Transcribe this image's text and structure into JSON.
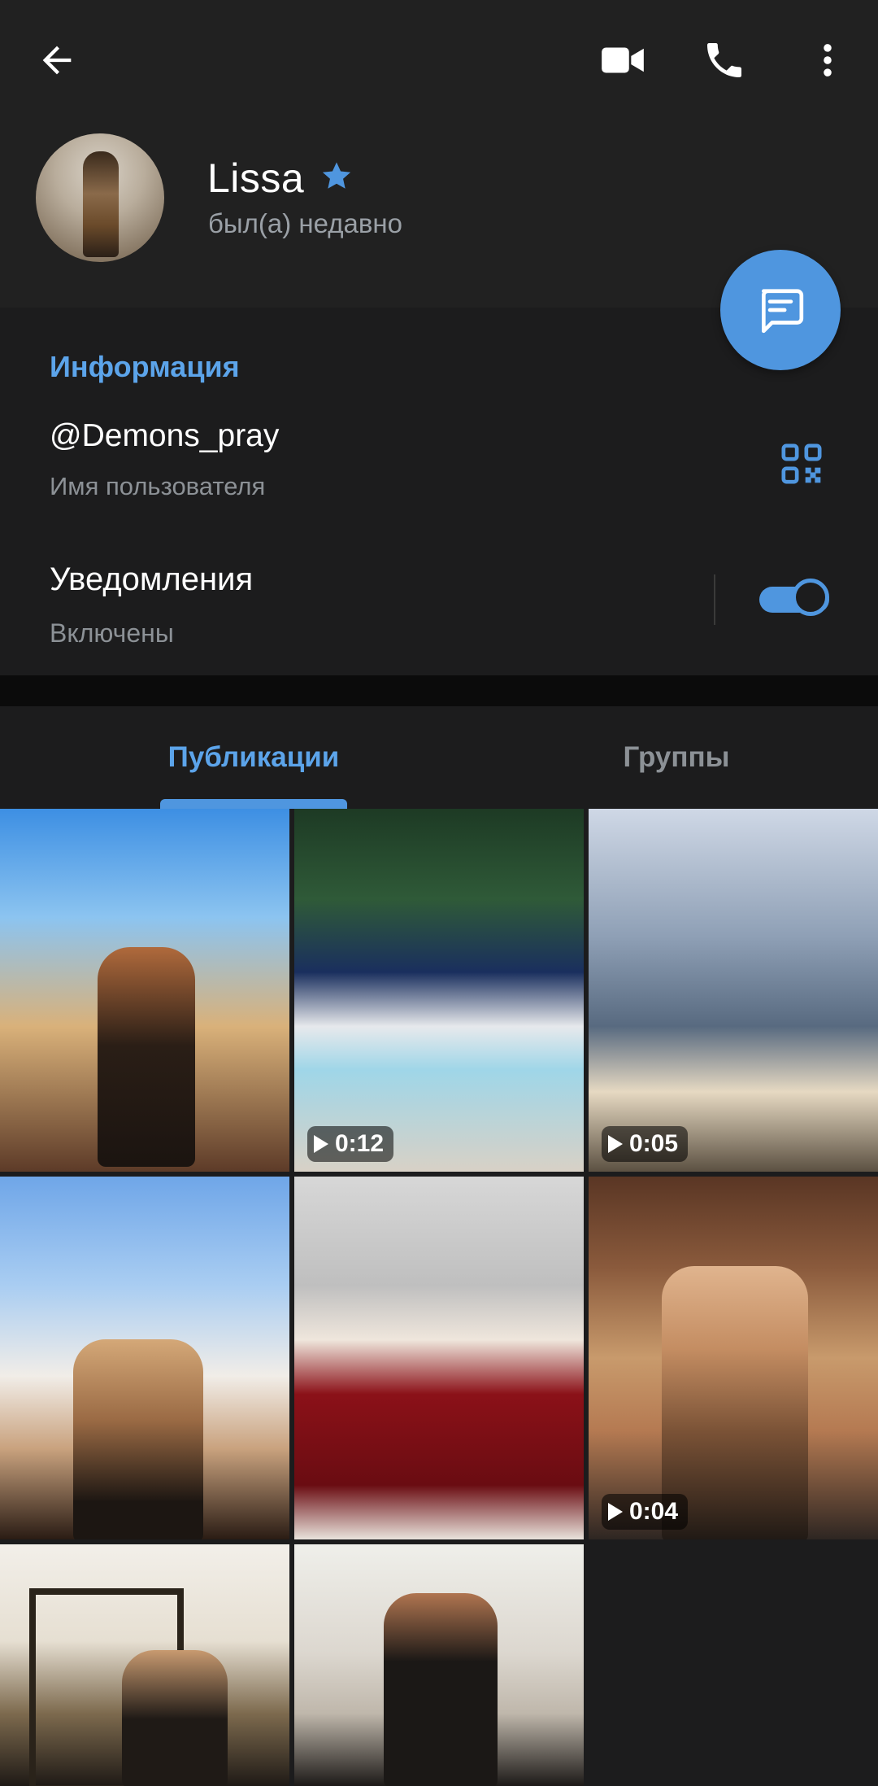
{
  "toolbar": {
    "back_icon": "arrow-left-icon",
    "video_icon": "video-camera-icon",
    "call_icon": "phone-icon",
    "more_icon": "more-vertical-icon"
  },
  "profile": {
    "name": "Lissa",
    "badge_icon": "star-icon",
    "status": "был(а) недавно",
    "avatar_icon": "avatar"
  },
  "fab": {
    "icon": "message-icon"
  },
  "info": {
    "section_title": "Информация",
    "username": "@Demons_pray",
    "username_label": "Имя пользователя",
    "qr_icon": "qr-code-icon",
    "notifications_title": "Уведомления",
    "notifications_status": "Включены",
    "notifications_enabled": true
  },
  "tabs": [
    {
      "label": "Публикации",
      "active": true
    },
    {
      "label": "Группы",
      "active": false
    }
  ],
  "media": [
    {
      "type": "photo"
    },
    {
      "type": "video",
      "duration": "0:12"
    },
    {
      "type": "video",
      "duration": "0:05"
    },
    {
      "type": "photo"
    },
    {
      "type": "photo"
    },
    {
      "type": "video",
      "duration": "0:04"
    },
    {
      "type": "photo"
    },
    {
      "type": "photo"
    }
  ],
  "colors": {
    "accent": "#4f96df",
    "link": "#5ca4ea",
    "background": "#1c1c1d",
    "header": "#212121"
  }
}
